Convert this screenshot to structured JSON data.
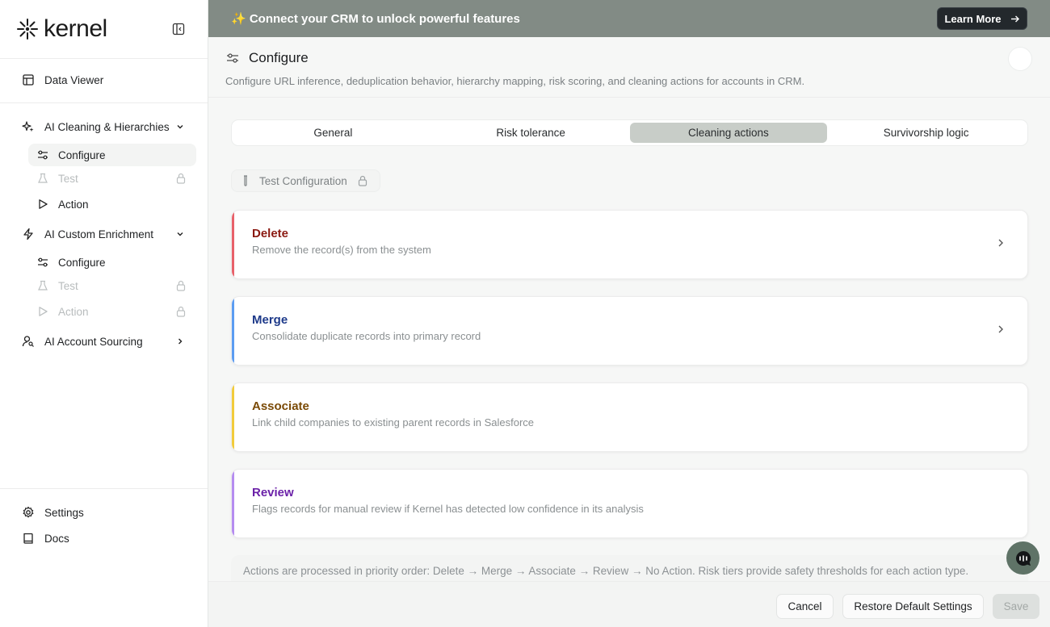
{
  "brand": {
    "name": "kernel"
  },
  "sidebar": {
    "data_viewer": "Data Viewer",
    "groups": [
      {
        "label": "AI Cleaning & Hierarchies",
        "items": [
          {
            "label": "Configure"
          },
          {
            "label": "Test"
          },
          {
            "label": "Action"
          }
        ]
      },
      {
        "label": "AI Custom Enrichment",
        "items": [
          {
            "label": "Configure"
          },
          {
            "label": "Test"
          },
          {
            "label": "Action"
          }
        ]
      },
      {
        "label": "AI Account Sourcing"
      }
    ],
    "settings": "Settings",
    "docs": "Docs"
  },
  "banner": {
    "text": "✨ Connect your CRM to unlock powerful features",
    "button": "Learn More"
  },
  "header": {
    "title": "Configure",
    "subtitle": "Configure URL inference, deduplication behavior, hierarchy mapping, risk scoring, and cleaning actions for accounts in CRM."
  },
  "tabs": [
    {
      "label": "General"
    },
    {
      "label": "Risk tolerance"
    },
    {
      "label": "Cleaning actions"
    },
    {
      "label": "Survivorship logic"
    }
  ],
  "test_config": "Test Configuration",
  "actions": [
    {
      "title": "Delete",
      "description": "Remove the record(s) from the system",
      "color": "#8b1a12",
      "accent": "#e8616a"
    },
    {
      "title": "Merge",
      "description": "Consolidate duplicate records into primary record",
      "color": "#1e3a8a",
      "accent": "#5b9cf2"
    },
    {
      "title": "Associate",
      "description": "Link child companies to existing parent records in Salesforce",
      "color": "#7a4a06",
      "accent": "#f2cb3a"
    },
    {
      "title": "Review",
      "description": "Flags records for manual review if Kernel has detected low confidence in its analysis",
      "color": "#6b21a8",
      "accent": "#b58cf0"
    }
  ],
  "note": "Actions are processed in priority order: Delete → Merge → Associate → Review → No Action. Risk tiers provide safety thresholds for each action type.",
  "footer": {
    "cancel": "Cancel",
    "restore": "Restore Default Settings",
    "save": "Save"
  }
}
